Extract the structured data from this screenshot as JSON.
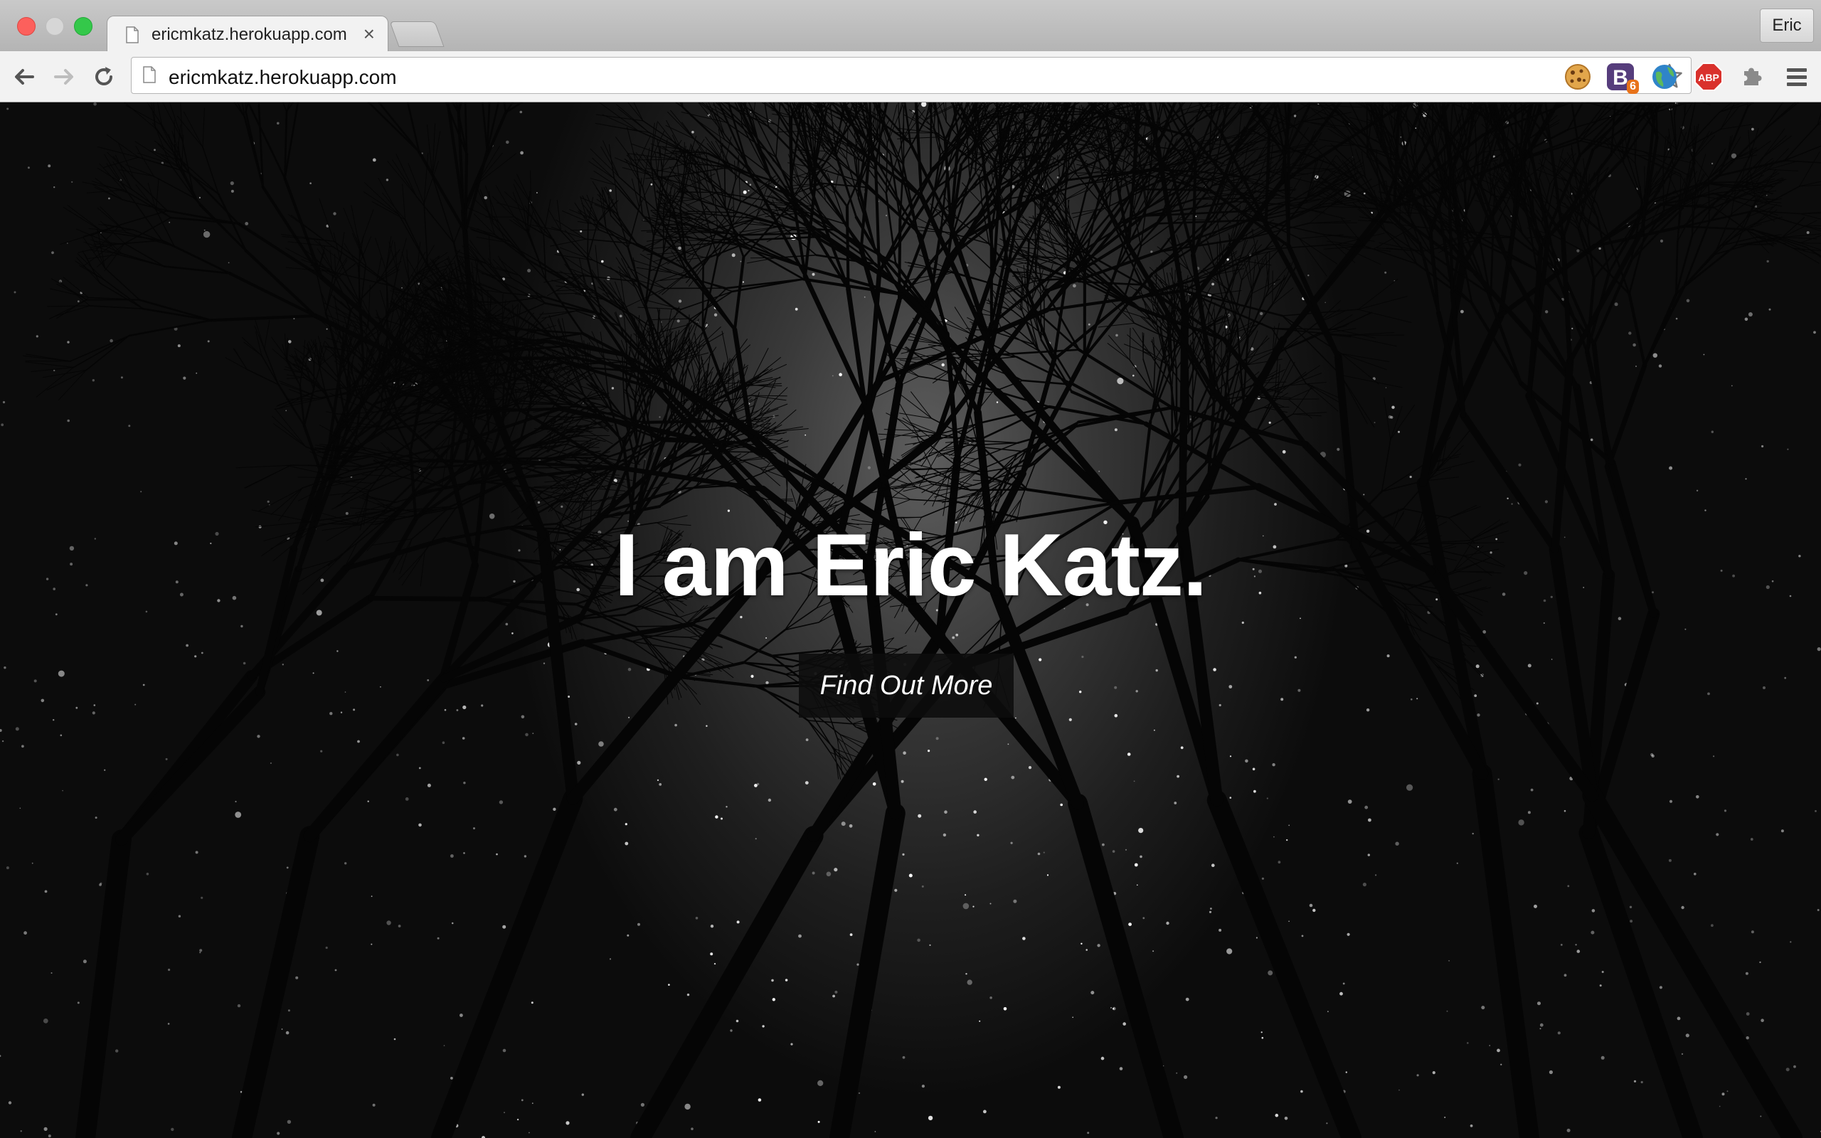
{
  "browser": {
    "tab": {
      "title": "ericmkatz.herokuapp.com",
      "close": "×"
    },
    "profile": "Eric",
    "address": {
      "url": "ericmkatz.herokuapp.com"
    },
    "extensions": [
      {
        "icon": "cookie-extension-icon"
      },
      {
        "icon": "bootstrap-extension-icon",
        "badge": "6"
      },
      {
        "icon": "globe-extension-icon"
      },
      {
        "icon": "adblock-plus-icon",
        "label": "ABP"
      },
      {
        "icon": "puzzle-extension-icon"
      }
    ]
  },
  "hero": {
    "title": "I am Eric Katz.",
    "button": "Find Out More"
  }
}
